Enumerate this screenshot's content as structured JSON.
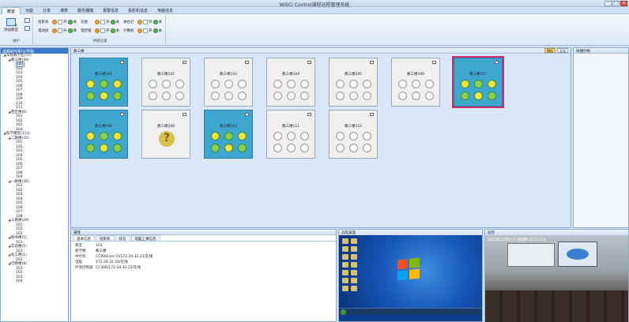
{
  "window": {
    "title": "WiSCI Control课程远程管理系统"
  },
  "tabs": [
    "教室",
    "功能",
    "分享",
    "课表",
    "服务器端",
    "报警信息",
    "投影机信息",
    "电脑信息"
  ],
  "ribbon": {
    "maintain_group": "维护",
    "add_room_label": "添加教室",
    "control_group": "快捷设置",
    "rows": [
      {
        "label": "投影机",
        "on": "开",
        "off": "关"
      },
      {
        "label": "电动屏",
        "on": "升",
        "off": "降"
      },
      {
        "label": "功放",
        "on": "开",
        "off": "关"
      },
      {
        "label": "电控锁",
        "on": "开",
        "off": "关"
      },
      {
        "label": "讲台灯",
        "on": "开",
        "off": "关"
      },
      {
        "label": "计算机",
        "on": "开",
        "off": "关"
      }
    ]
  },
  "tree": {
    "header": "成都航空职业学院",
    "items": [
      "东院教学区(71)",
      "教三楼(49)",
      "101",
      "102",
      "103",
      "104",
      "105",
      "106",
      "107",
      "108",
      "109",
      "110",
      "111",
      "西区楼(6)",
      "101",
      "102",
      "103",
      "104",
      "科学楼区(113)",
      "二教楼(35)",
      "101",
      "102",
      "103",
      "104",
      "105",
      "106",
      "107",
      "108",
      "109",
      "一教楼(36)",
      "101",
      "102",
      "103",
      "104",
      "105",
      "106",
      "107",
      "108",
      "三教楼(29)",
      "101",
      "102",
      "103",
      "图书楼(5)",
      "101",
      "实验楼(1)",
      "101",
      "化工楼(1)",
      "101",
      "行政楼(8)",
      "101",
      "102",
      "103",
      "104"
    ]
  },
  "main": {
    "header": "教三楼",
    "tool_a": "图标",
    "tool_b": "全选",
    "rooms": [
      {
        "name": "教三楼101",
        "state": "on"
      },
      {
        "name": "教三楼102",
        "state": "off"
      },
      {
        "name": "教三楼103",
        "state": "off"
      },
      {
        "name": "教三楼104",
        "state": "off"
      },
      {
        "name": "教三楼105",
        "state": "off"
      },
      {
        "name": "教三楼106",
        "state": "off"
      },
      {
        "name": "教三楼107",
        "state": "on"
      },
      {
        "name": "教三楼108",
        "state": "on"
      },
      {
        "name": "教三楼109",
        "state": "unknown"
      },
      {
        "name": "教三楼110",
        "state": "on"
      },
      {
        "name": "教三楼111",
        "state": "off"
      },
      {
        "name": "教三楼112",
        "state": "off"
      }
    ]
  },
  "right_panel": {
    "title": "快捷控制"
  },
  "props": {
    "title": "属性",
    "tabs": [
      "基本信息",
      "投影机",
      "状态",
      "电脑上课信息"
    ],
    "rows": [
      {
        "k": "教室",
        "v": "101"
      },
      {
        "k": "教学楼",
        "v": "教三楼"
      },
      {
        "k": "中控机",
        "v": "CC900(ver:2)/172.24.32.21/在线"
      },
      {
        "k": "电脑",
        "v": "172.24.32.20/在线"
      },
      {
        "k": "环境控制器",
        "v": "CC306/172.24.32.22/在线"
      }
    ]
  },
  "remote": {
    "title": "远程桌面"
  },
  "monitor": {
    "title": "监控",
    "timestamp": "2013年11月07日 星期四 11:21:14"
  },
  "colors": {
    "accent": "#3ea7d0",
    "selected_outline": "#d0306a"
  }
}
